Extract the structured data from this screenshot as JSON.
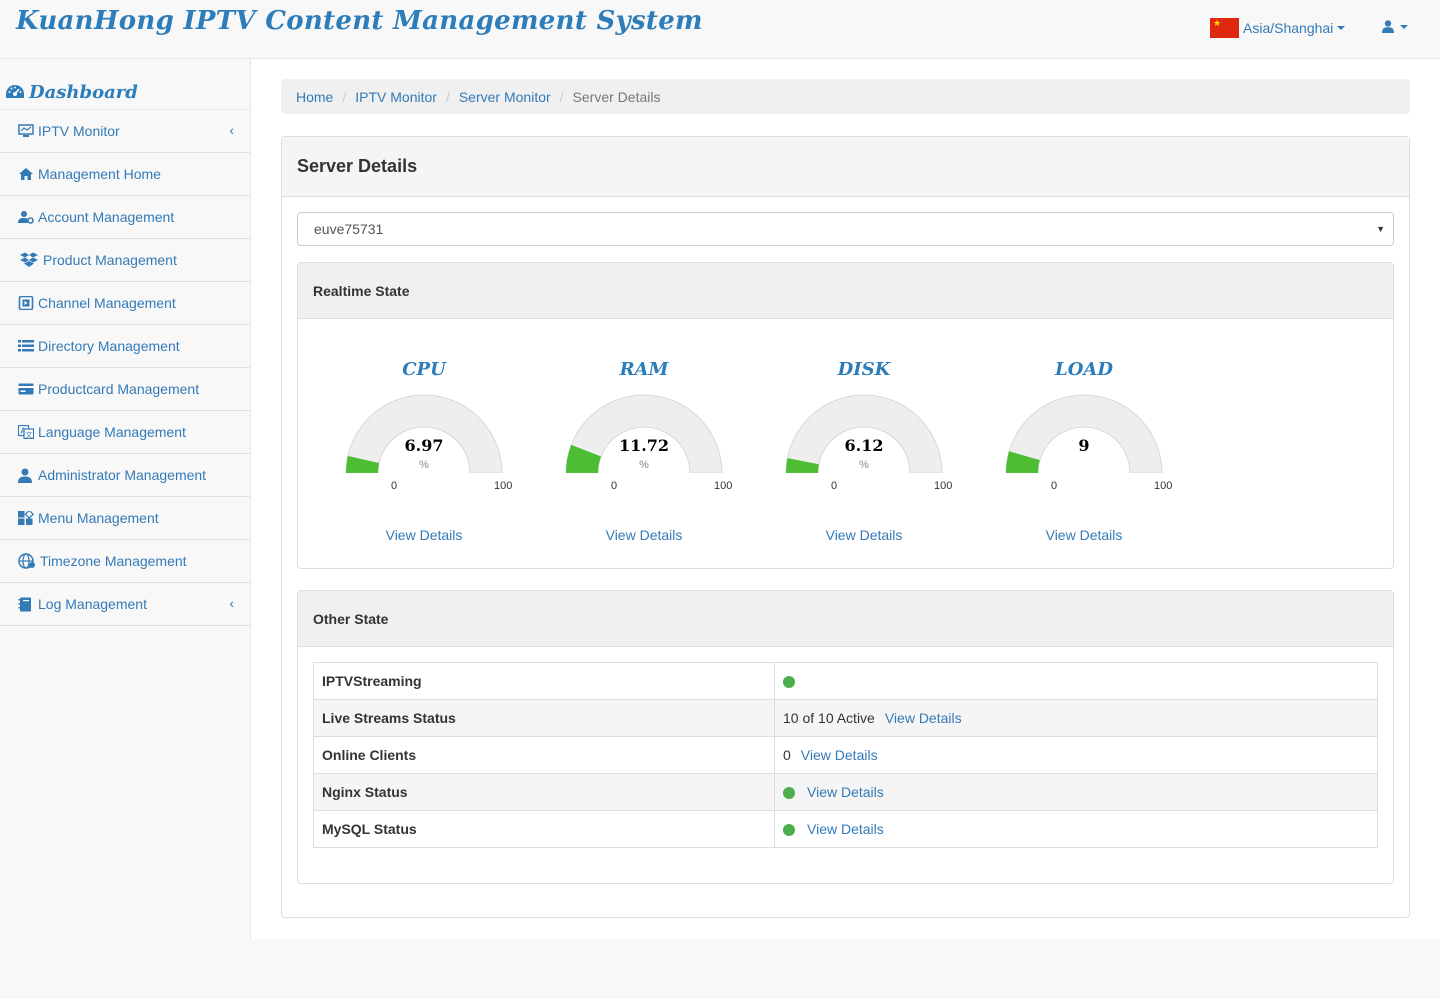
{
  "header": {
    "brand": "KuanHong IPTV Content Management System",
    "timezone": "Asia/Shanghai"
  },
  "sidebar": {
    "title": "Dashboard",
    "items": [
      {
        "label": "IPTV Monitor",
        "icon": "desktop-icon",
        "has_submenu": true
      },
      {
        "label": "Management Home",
        "icon": "home-icon"
      },
      {
        "label": "Account Management",
        "icon": "user-gear-icon"
      },
      {
        "label": "Product Management",
        "icon": "dropbox-icon"
      },
      {
        "label": "Channel Management",
        "icon": "play-square-icon"
      },
      {
        "label": "Directory Management",
        "icon": "list-icon"
      },
      {
        "label": "Productcard Management",
        "icon": "card-icon"
      },
      {
        "label": "Language Management",
        "icon": "language-icon"
      },
      {
        "label": "Administrator Management",
        "icon": "user-icon"
      },
      {
        "label": "Menu Management",
        "icon": "grid-icon"
      },
      {
        "label": "Timezone Management",
        "icon": "globe-icon"
      },
      {
        "label": "Log Management",
        "icon": "book-icon",
        "has_submenu": true
      }
    ]
  },
  "breadcrumb": [
    "Home",
    "IPTV Monitor",
    "Server Monitor",
    "Server Details"
  ],
  "panel": {
    "title": "Server Details",
    "server_select": "euve75731"
  },
  "realtime": {
    "title": "Realtime State",
    "gauges": [
      {
        "title": "CPU",
        "value": "6.97",
        "level": 6.97,
        "unit": "%",
        "min": "0",
        "max": "100",
        "link": "View Details"
      },
      {
        "title": "RAM",
        "value": "11.72",
        "level": 11.72,
        "unit": "%",
        "min": "0",
        "max": "100",
        "link": "View Details"
      },
      {
        "title": "DISK",
        "value": "6.12",
        "level": 6.12,
        "unit": "%",
        "min": "0",
        "max": "100",
        "link": "View Details"
      },
      {
        "title": "LOAD",
        "value": "9",
        "level": 9,
        "unit": "",
        "min": "0",
        "max": "100",
        "link": "View Details"
      }
    ]
  },
  "other": {
    "title": "Other State",
    "rows": [
      {
        "label": "IPTVStreaming",
        "status_dot": true,
        "text": "",
        "link": ""
      },
      {
        "label": "Live Streams Status",
        "status_dot": false,
        "text": "10 of 10 Active",
        "link": "View Details"
      },
      {
        "label": "Online Clients",
        "status_dot": false,
        "text": "0",
        "link": "View Details"
      },
      {
        "label": "Nginx Status",
        "status_dot": true,
        "text": "",
        "link": "View Details"
      },
      {
        "label": "MySQL Status",
        "status_dot": true,
        "text": "",
        "link": "View Details"
      }
    ]
  },
  "colors": {
    "brand": "#2d7dbb",
    "link": "#337ab7",
    "gauge_fill": "#4dbd33",
    "gauge_track": "#eeeeee",
    "status_ok": "#4cae4c"
  }
}
